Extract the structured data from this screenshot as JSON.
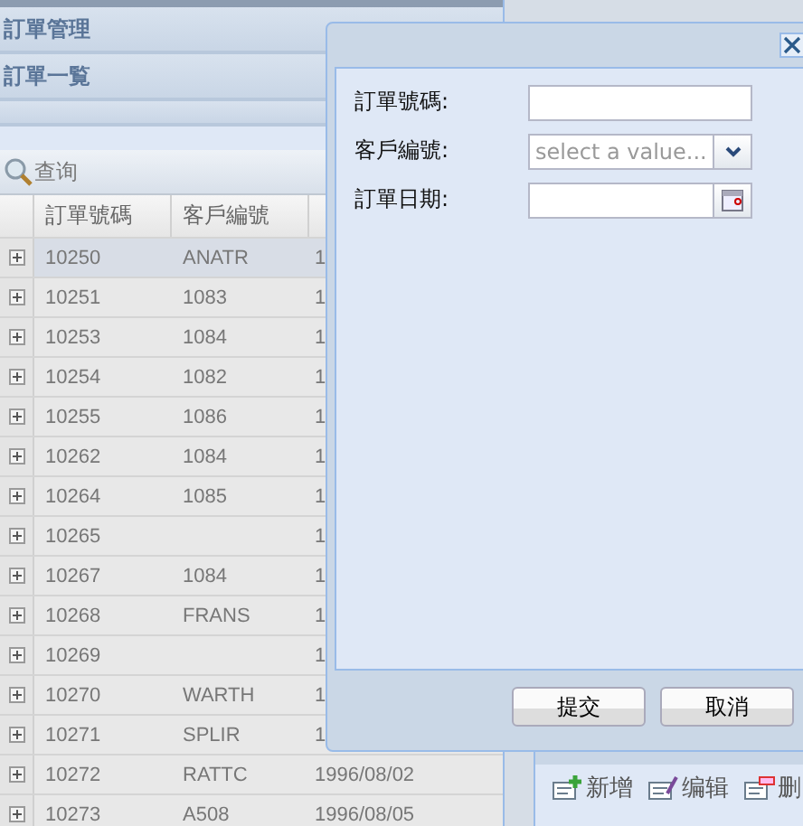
{
  "accordion": [
    {
      "title": "訂單管理"
    },
    {
      "title": "訂單一覧"
    }
  ],
  "toolbar": {
    "search_button": "查询"
  },
  "grid": {
    "columns": [
      "訂單號碼",
      "客戶編號"
    ],
    "rows": [
      {
        "order_no": "10250",
        "customer": "ANATR",
        "column_3": "1",
        "selected": true
      },
      {
        "order_no": "10251",
        "customer": "1083",
        "column_3": "1",
        "selected": false
      },
      {
        "order_no": "10253",
        "customer": "1084",
        "column_3": "1",
        "selected": false
      },
      {
        "order_no": "10254",
        "customer": "1082",
        "column_3": "1",
        "selected": false
      },
      {
        "order_no": "10255",
        "customer": "1086",
        "column_3": "1",
        "selected": false
      },
      {
        "order_no": "10262",
        "customer": "1084",
        "column_3": "1",
        "selected": false
      },
      {
        "order_no": "10264",
        "customer": "1085",
        "column_3": "1",
        "selected": false
      },
      {
        "order_no": "10265",
        "customer": "",
        "column_3": "1",
        "selected": false
      },
      {
        "order_no": "10267",
        "customer": "1084",
        "column_3": "1",
        "selected": false
      },
      {
        "order_no": "10268",
        "customer": "FRANS",
        "column_3": "1",
        "selected": false
      },
      {
        "order_no": "10269",
        "customer": "",
        "column_3": "1",
        "selected": false
      },
      {
        "order_no": "10270",
        "customer": "WARTH",
        "column_3": "1",
        "selected": false
      },
      {
        "order_no": "10271",
        "customer": "SPLIR",
        "column_3": "1",
        "selected": false
      },
      {
        "order_no": "10272",
        "customer": "RATTC",
        "column_3": "1996/08/02",
        "selected": false
      },
      {
        "order_no": "10273",
        "customer": "A508",
        "column_3": "1996/08/05",
        "selected": false
      }
    ]
  },
  "detail_toolbar": [
    "新增",
    "编辑",
    "删"
  ],
  "dialog": {
    "fields": [
      {
        "label": "訂單號碼:",
        "kind": "text"
      },
      {
        "label": "客戶編號:",
        "kind": "select",
        "placeholder": "select a value..."
      },
      {
        "label": "訂單日期:",
        "kind": "date"
      }
    ],
    "buttons": [
      "提交",
      "取消"
    ]
  }
}
